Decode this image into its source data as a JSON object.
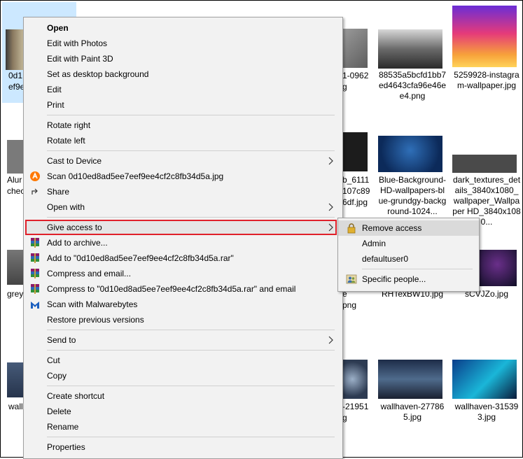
{
  "explorer": {
    "selected_file_label_lines": [
      "0d1",
      "ef9e"
    ],
    "files": [
      {
        "label": "88535a5bcfd1bb7ed4643cfa96e46ee4.png"
      },
      {
        "label": "5259928-instagram-wallpaper.jpg"
      },
      {
        "label": "Blue-Background-HD-wallpapers-blue-grundgy-background-1024..."
      },
      {
        "label": "dark_textures_details_3840x1080_wallpaper_Wallpaper HD_3840x1080..."
      },
      {
        "label": "RHTexBW10.jpg"
      },
      {
        "label": "sCVJZo.jpg"
      },
      {
        "label": "wallhaven-277865.jpg"
      },
      {
        "label": "wallhaven-315393.jpg"
      }
    ],
    "partial_labels": {
      "col1_row2_a": "Alur",
      "col1_row2_b": "chec",
      "col1_row3": "grey",
      "col1_row4": "wall",
      "col3_row1_a": "1-0962",
      "col3_row1_b": "g",
      "col3_row2_a": "b_6111",
      "col3_row2_b": "107c89",
      "col3_row2_c": "6df.jpg",
      "col3_row3_a": "e",
      "col3_row3_b": "png",
      "col3_row4_a": "-21951",
      "col3_row4_b": "g"
    }
  },
  "context_menu": {
    "items": [
      {
        "label": "Open",
        "bold": true
      },
      {
        "label": "Edit with Photos"
      },
      {
        "label": "Edit with Paint 3D"
      },
      {
        "label": "Set as desktop background"
      },
      {
        "label": "Edit"
      },
      {
        "label": "Print"
      },
      {
        "label": "Rotate right"
      },
      {
        "label": "Rotate left"
      },
      {
        "label": "Cast to Device",
        "submenu": true
      },
      {
        "label": "Scan 0d10ed8ad5ee7eef9ee4cf2c8fb34d5a.jpg",
        "icon": "avast-icon"
      },
      {
        "label": "Share",
        "icon": "share-icon"
      },
      {
        "label": "Open with",
        "submenu": true
      },
      {
        "label": "Give access to",
        "submenu": true,
        "highlighted": true
      },
      {
        "label": "Add to archive...",
        "icon": "winrar-icon"
      },
      {
        "label": "Add to \"0d10ed8ad5ee7eef9ee4cf2c8fb34d5a.rar\"",
        "icon": "winrar-icon"
      },
      {
        "label": "Compress and email...",
        "icon": "winrar-icon"
      },
      {
        "label": "Compress to \"0d10ed8ad5ee7eef9ee4cf2c8fb34d5a.rar\" and email",
        "icon": "winrar-icon"
      },
      {
        "label": "Scan with Malwarebytes",
        "icon": "malwarebytes-icon"
      },
      {
        "label": "Restore previous versions"
      },
      {
        "label": "Send to",
        "submenu": true
      },
      {
        "label": "Cut"
      },
      {
        "label": "Copy"
      },
      {
        "label": "Create shortcut"
      },
      {
        "label": "Delete"
      },
      {
        "label": "Rename"
      },
      {
        "label": "Properties"
      }
    ]
  },
  "give_access_submenu": {
    "items": [
      {
        "label": "Remove access",
        "icon": "lock-icon",
        "hovered": true
      },
      {
        "label": "Admin"
      },
      {
        "label": "defaultuser0"
      },
      {
        "label": "Specific people...",
        "icon": "people-icon"
      }
    ]
  },
  "colors": {
    "highlight_border": "#e0202a",
    "selection": "#cce8ff",
    "menu_bg": "#f2f2f2"
  }
}
